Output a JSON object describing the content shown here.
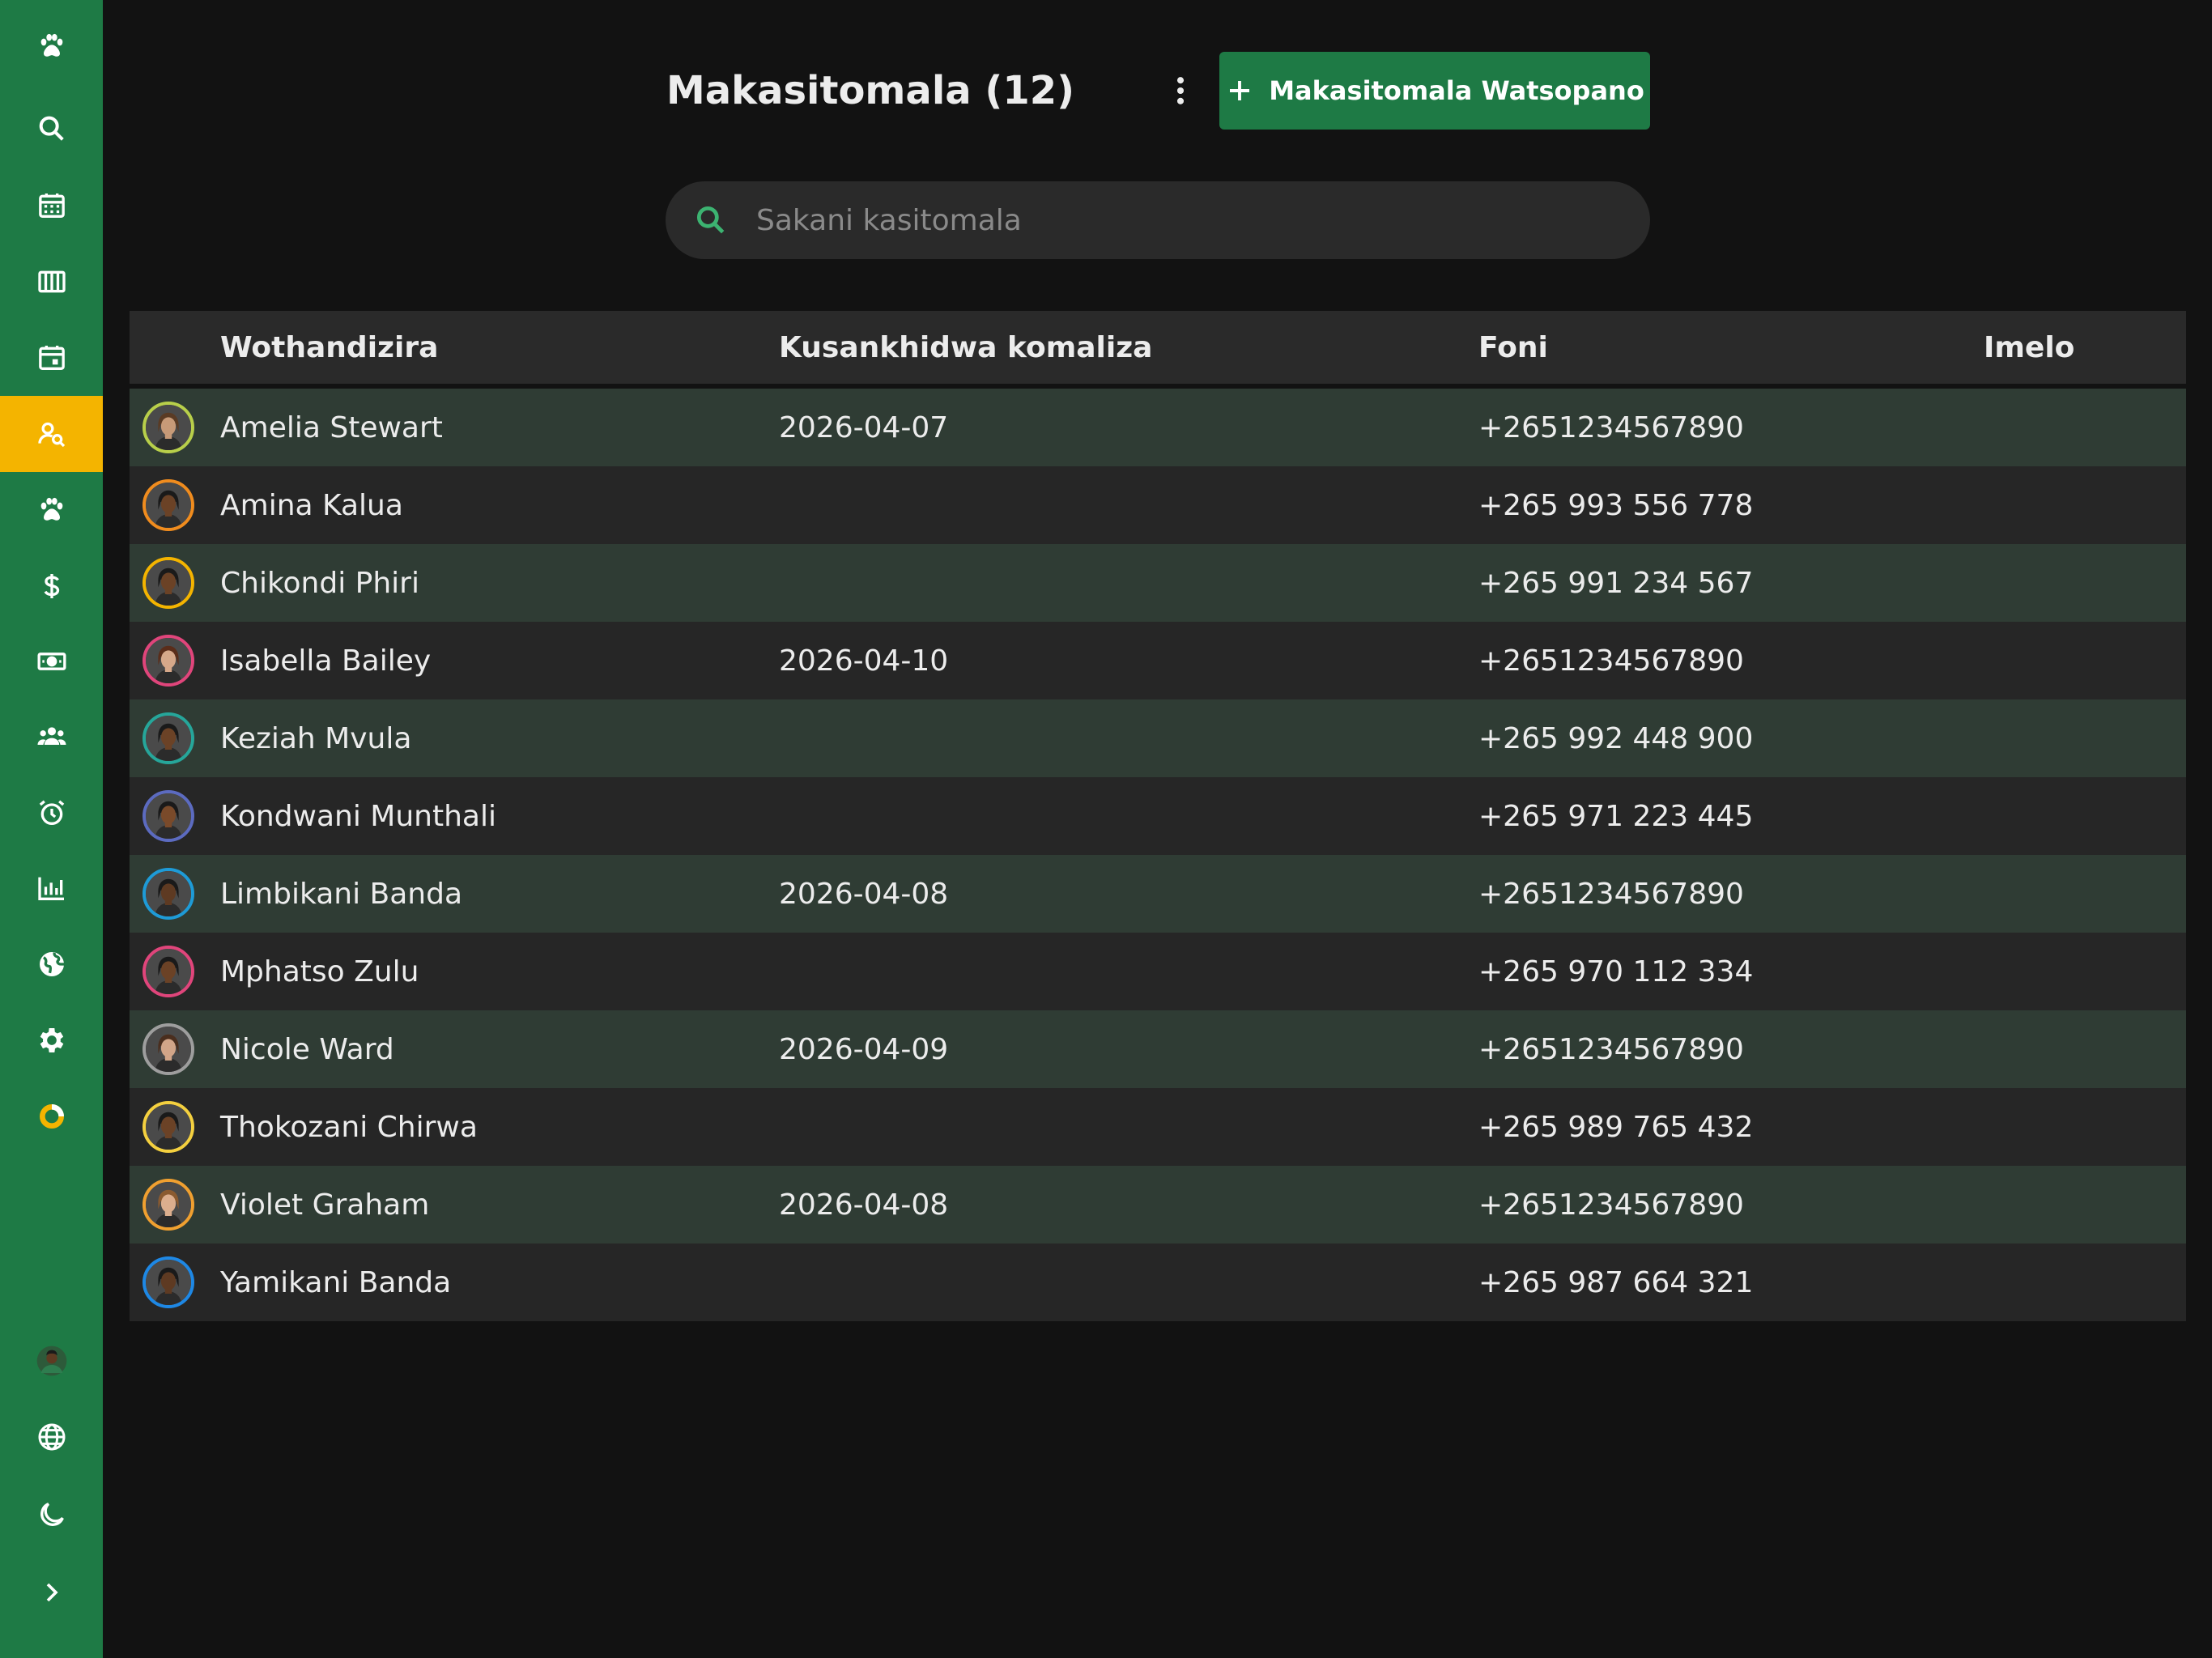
{
  "header": {
    "title": "Makasitomala (12)",
    "new_button_label": "Makasitomala Watsopano"
  },
  "search": {
    "placeholder": "Sakani kasitomala",
    "value": ""
  },
  "table": {
    "columns": [
      "Wothandizira",
      "Kusankhidwa komaliza",
      "Foni",
      "Imelo"
    ],
    "rows": [
      {
        "name": "Amelia Stewart",
        "last_appointment": "2026-04-07",
        "phone": "+2651234567890",
        "email": "",
        "ring": "#b8cf4a",
        "skin": "#c79a78",
        "hair": "#5a3b24"
      },
      {
        "name": "Amina Kalua",
        "last_appointment": "",
        "phone": "+265 993 556 778",
        "email": "",
        "ring": "#f08c1e",
        "skin": "#6b4226",
        "hair": "#1a1a1a"
      },
      {
        "name": "Chikondi Phiri",
        "last_appointment": "",
        "phone": "+265 991 234 567",
        "email": "",
        "ring": "#f4b400",
        "skin": "#6b4226",
        "hair": "#1a1a1a"
      },
      {
        "name": "Isabella Bailey",
        "last_appointment": "2026-04-10",
        "phone": "+2651234567890",
        "email": "",
        "ring": "#e0457b",
        "skin": "#d6a88a",
        "hair": "#5a2d1a"
      },
      {
        "name": "Keziah Mvula",
        "last_appointment": "",
        "phone": "+265 992 448 900",
        "email": "",
        "ring": "#26a69a",
        "skin": "#6b4226",
        "hair": "#1a1a1a"
      },
      {
        "name": "Kondwani Munthali",
        "last_appointment": "",
        "phone": "+265 971 223 445",
        "email": "",
        "ring": "#5c6bc0",
        "skin": "#7a4a2a",
        "hair": "#1a1a1a"
      },
      {
        "name": "Limbikani Banda",
        "last_appointment": "2026-04-08",
        "phone": "+2651234567890",
        "email": "",
        "ring": "#1e9bd7",
        "skin": "#5e3a22",
        "hair": "#1a1a1a"
      },
      {
        "name": "Mphatso Zulu",
        "last_appointment": "",
        "phone": "+265 970 112 334",
        "email": "",
        "ring": "#e0457b",
        "skin": "#6b4226",
        "hair": "#1a1a1a"
      },
      {
        "name": "Nicole Ward",
        "last_appointment": "2026-04-09",
        "phone": "+2651234567890",
        "email": "",
        "ring": "#9e9e9e",
        "skin": "#d2a588",
        "hair": "#4a2e1e"
      },
      {
        "name": "Thokozani Chirwa",
        "last_appointment": "",
        "phone": "+265 989 765 432",
        "email": "",
        "ring": "#f4d03f",
        "skin": "#6b4226",
        "hair": "#1a1a1a"
      },
      {
        "name": "Violet Graham",
        "last_appointment": "2026-04-08",
        "phone": "+2651234567890",
        "email": "",
        "ring": "#f0a030",
        "skin": "#dcae8e",
        "hair": "#8a5a30"
      },
      {
        "name": "Yamikani Banda",
        "last_appointment": "",
        "phone": "+265 987 664 321",
        "email": "",
        "ring": "#1e88e5",
        "skin": "#5e3a22",
        "hair": "#1a1a1a"
      }
    ]
  },
  "sidebar": {
    "items": [
      {
        "icon": "paw-logo-icon"
      },
      {
        "icon": "search-icon"
      },
      {
        "icon": "calendar-grid-icon"
      },
      {
        "icon": "columns-icon"
      },
      {
        "icon": "calendar-day-icon"
      },
      {
        "icon": "customer-search-icon",
        "active": true
      },
      {
        "icon": "paw-icon"
      },
      {
        "icon": "dollar-icon"
      },
      {
        "icon": "cash-icon"
      },
      {
        "icon": "group-icon"
      },
      {
        "icon": "alarm-icon"
      },
      {
        "icon": "bar-chart-icon"
      },
      {
        "icon": "globe-filled-icon"
      },
      {
        "icon": "gear-icon"
      },
      {
        "icon": "donut-icon"
      }
    ],
    "bottom": [
      {
        "icon": "user-avatar"
      },
      {
        "icon": "language-icon"
      },
      {
        "icon": "moon-icon"
      },
      {
        "icon": "chevron-right-icon"
      }
    ]
  },
  "colors": {
    "sidebar": "#1e7a45",
    "accent": "#f4b400",
    "background": "#121212",
    "row_odd": "#2f3c34",
    "row_even": "#262626",
    "search_icon": "#3cb371"
  }
}
